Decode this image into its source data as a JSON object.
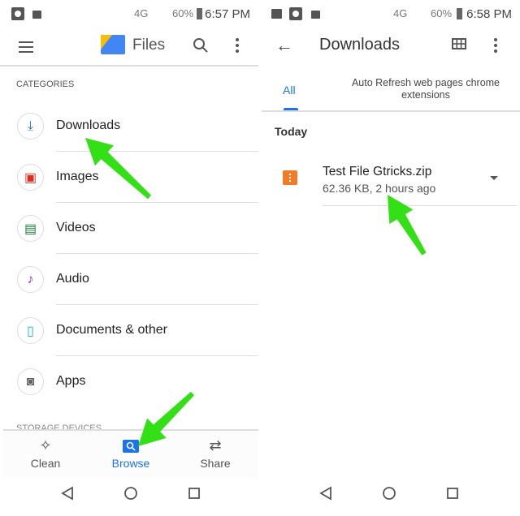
{
  "left": {
    "status": {
      "time": "6:57 PM",
      "battery": "60%",
      "network": "4G"
    },
    "appbar": {
      "title": "Files",
      "icons": [
        "menu-icon",
        "files-logo",
        "search-icon",
        "more-vert-icon"
      ]
    },
    "section_header": "CATEGORIES",
    "categories": [
      {
        "label": "Downloads",
        "icon": "download-icon",
        "color": "#1a73e8"
      },
      {
        "label": "Images",
        "icon": "image-icon",
        "color": "#d93025"
      },
      {
        "label": "Videos",
        "icon": "video-icon",
        "color": "#188038"
      },
      {
        "label": "Audio",
        "icon": "music-note-icon",
        "color": "#9334e6"
      },
      {
        "label": "Documents & other",
        "icon": "document-icon",
        "color": "#12b5cb"
      },
      {
        "label": "Apps",
        "icon": "android-icon",
        "color": "#5f6368"
      }
    ],
    "storage_header": "STORAGE DEVICES",
    "bottom_nav": [
      {
        "label": "Clean",
        "icon": "sparkle-icon",
        "active": false
      },
      {
        "label": "Browse",
        "icon": "browse-folder-icon",
        "active": true
      },
      {
        "label": "Share",
        "icon": "swap-arrows-icon",
        "active": false
      }
    ],
    "accent": "#1a73e8"
  },
  "right": {
    "status": {
      "time": "6:58 PM",
      "battery": "60%",
      "network": "4G"
    },
    "appbar": {
      "title": "Downloads"
    },
    "tabs": [
      {
        "label": "All",
        "active": true
      },
      {
        "label": "Auto Refresh web pages chrome extensions",
        "active": false
      }
    ],
    "group_header": "Today",
    "files": [
      {
        "name": "Test File Gtricks.zip",
        "meta": "62.36 KB, 2 hours ago",
        "icon": "zip-icon",
        "color": "#f07c27"
      }
    ]
  },
  "annotation_color": "#33e016"
}
